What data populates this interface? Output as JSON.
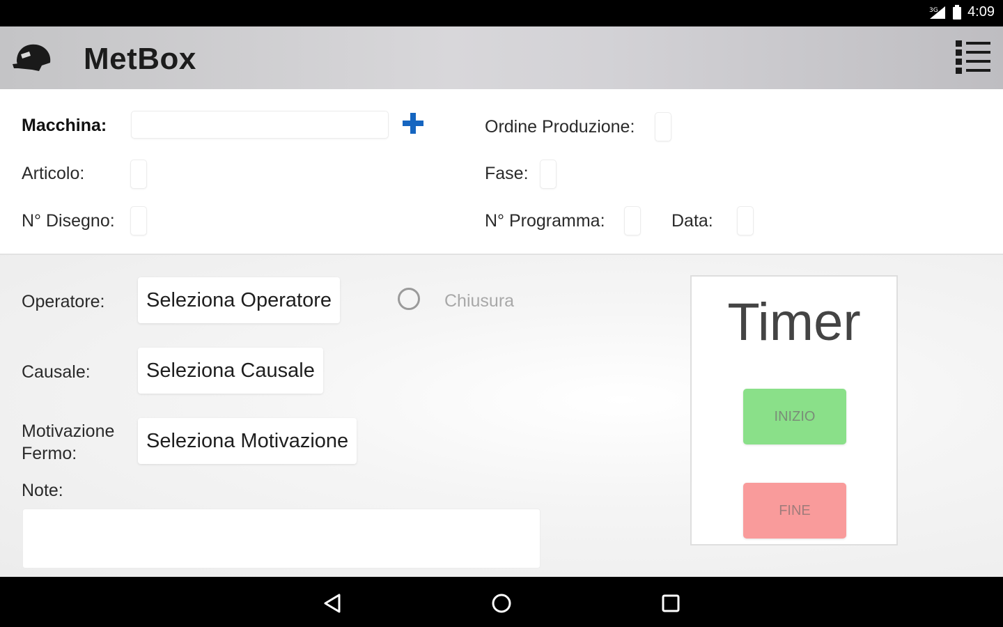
{
  "status_bar": {
    "time": "4:09",
    "icons": [
      "signal-icon",
      "battery-icon"
    ]
  },
  "app_bar": {
    "title": "MetBox",
    "logo_icon": "helmet-logo-icon",
    "menu_icon": "list-menu-icon"
  },
  "info": {
    "machine_label": "Macchina:",
    "machine_value": "",
    "add_icon": "plus-icon",
    "production_order_label": "Ordine Produzione:",
    "article_label": "Articolo:",
    "phase_label": "Fase:",
    "drawing_number_label": "N° Disegno:",
    "program_number_label": "N° Programma:",
    "date_label": "Data:"
  },
  "form": {
    "operator_label": "Operatore:",
    "operator_button": "Seleziona Operatore",
    "closure_label": "Chiusura",
    "reason_label": "Causale:",
    "reason_button": "Seleziona Causale",
    "stop_motivation_label_line1": "Motivazione",
    "stop_motivation_label_line2": "Fermo:",
    "stop_motivation_button": "Seleziona Motivazione",
    "notes_label": "Note:",
    "notes_value": ""
  },
  "timer": {
    "title": "Timer",
    "start_button": "INIZIO",
    "end_button": "FINE"
  },
  "nav_bar": {
    "icons": [
      "back-icon",
      "home-icon",
      "recents-icon"
    ]
  },
  "colors": {
    "accent_plus": "#1565c0",
    "start_green": "#8ae089",
    "end_red": "#f99b9b"
  }
}
